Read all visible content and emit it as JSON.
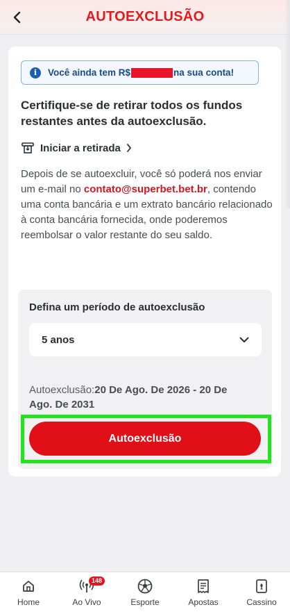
{
  "header": {
    "title": "AUTOEXCLUSÃO"
  },
  "notice": {
    "prefix": "Você ainda tem R$",
    "suffix": "na sua conta!"
  },
  "heading": "Certifique-se de retirar todos os fundos restantes antes da autoexclusão.",
  "withdraw_link": {
    "label": "Iniciar a retirada"
  },
  "info_text": {
    "before": "Depois de se autoexcluir, você só poderá nos enviar um e-mail no ",
    "email": "contato@superbet.bet.br",
    "after": ", contendo uma conta bancária e um extrato bancário relacionado à conta bancária fornecida, onde poderemos reembolsar o valor restante do seu saldo."
  },
  "period": {
    "label": "Defina um período de autoexclusão",
    "selected": "5 anos"
  },
  "range": {
    "prefix": "Autoexclusão:",
    "dates": "20 De Ago. De 2026 - 20 De Ago. De 2031"
  },
  "cta": {
    "label": "Autoexclusão"
  },
  "nav": {
    "items": [
      {
        "label": "Home",
        "icon": "home-icon"
      },
      {
        "label": "Ao Vivo",
        "icon": "live-icon",
        "badge": "148"
      },
      {
        "label": "Esporte",
        "icon": "soccer-ball-icon"
      },
      {
        "label": "Apostas",
        "icon": "receipt-icon"
      },
      {
        "label": "Cassino",
        "icon": "casino-card-icon"
      }
    ]
  },
  "colors": {
    "brand_red": "#e11a1e",
    "info_blue": "#1c5fb1",
    "highlight_green": "#22e41c"
  }
}
